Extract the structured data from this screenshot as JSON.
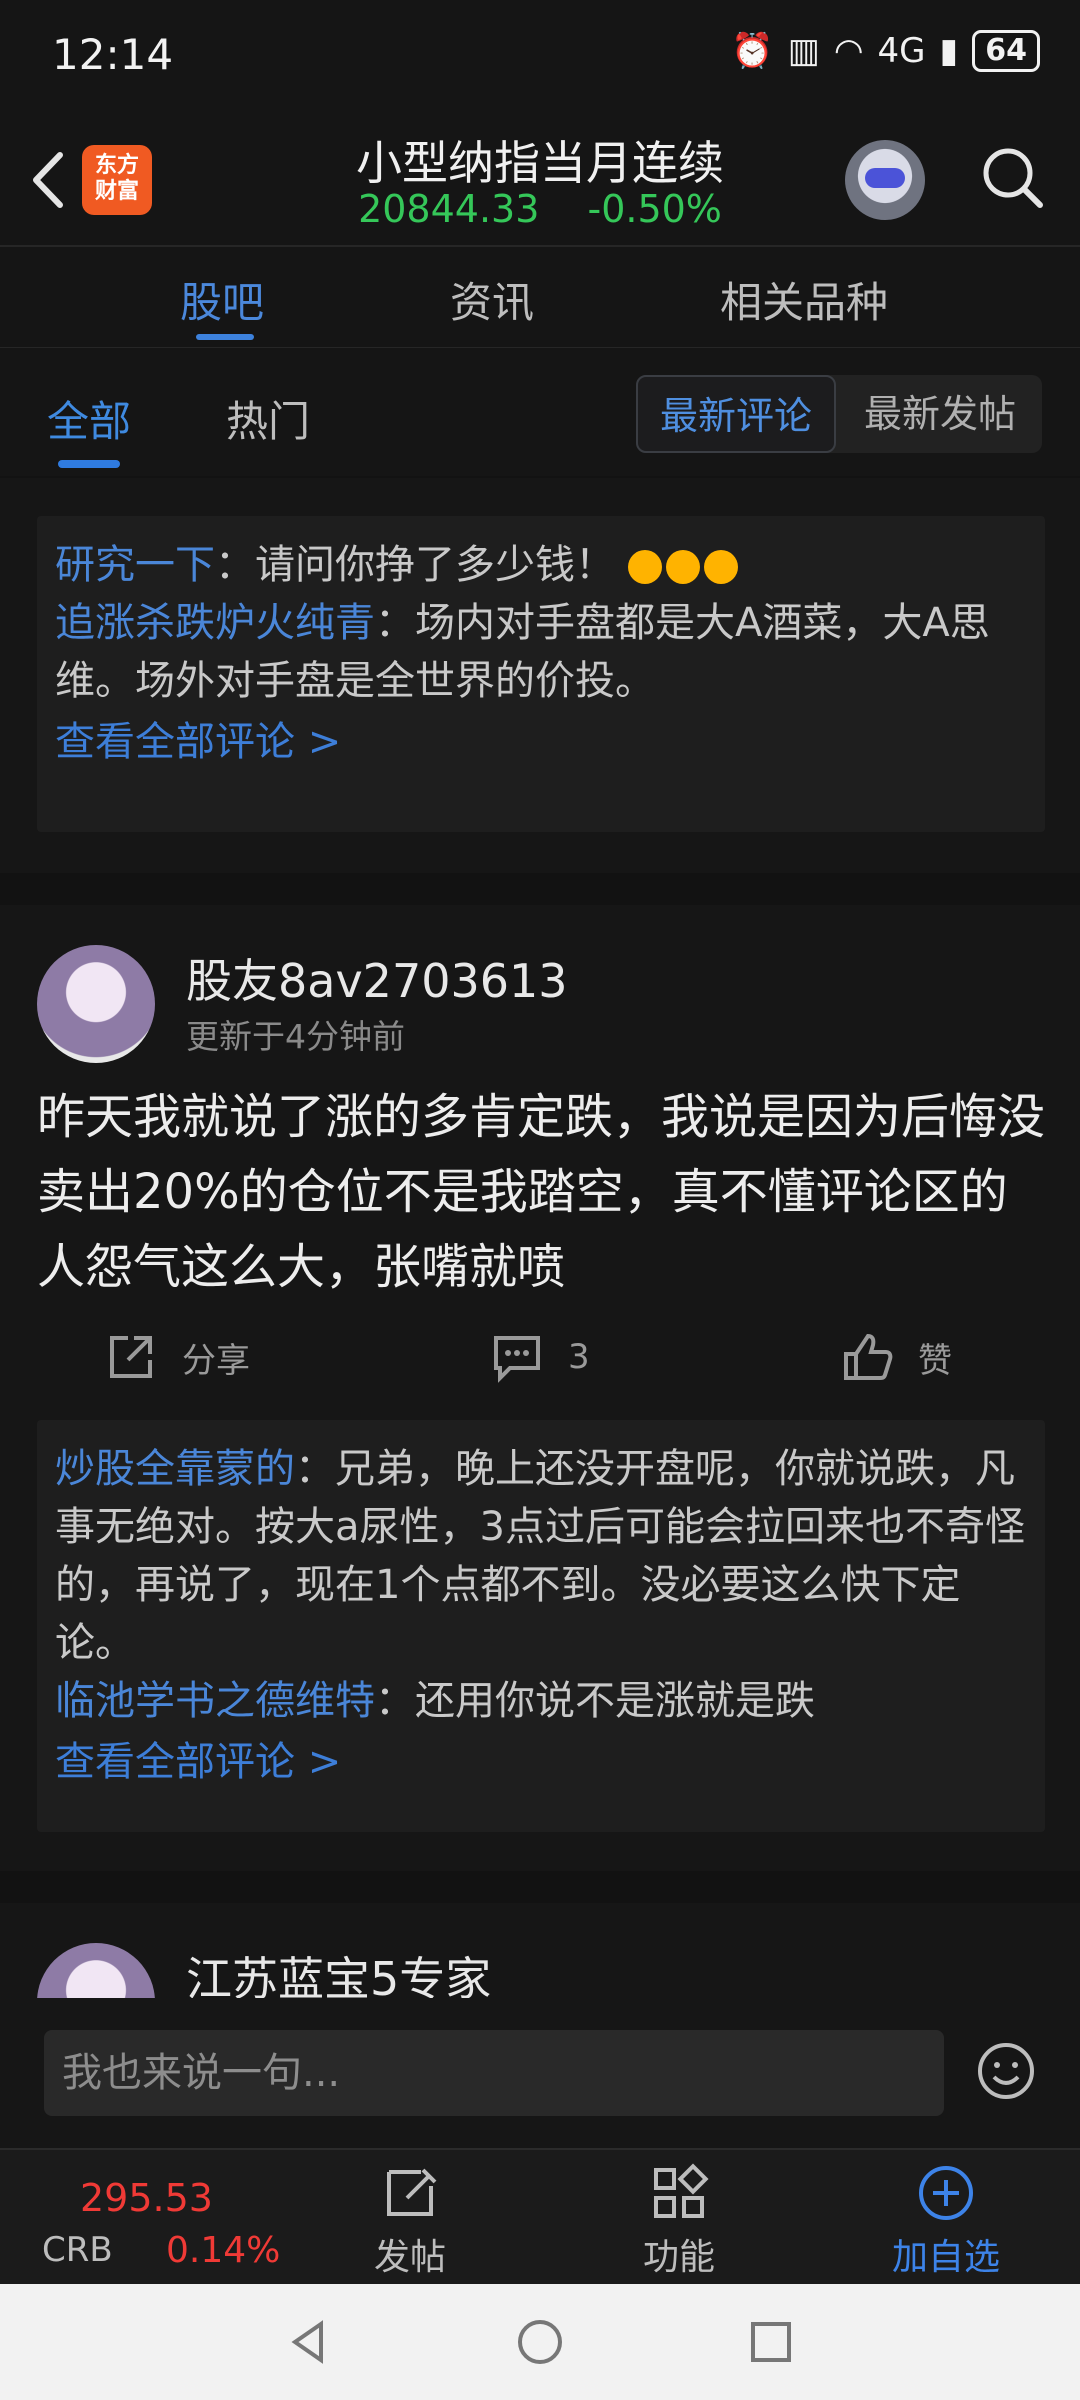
{
  "status_bar": {
    "time": "12:14",
    "network": "4G",
    "battery": "64"
  },
  "header": {
    "logo_text": "东方\n财富",
    "title": "小型纳指当月连续",
    "price": "20844.33",
    "change": "-0.50%",
    "change_color": "#35c759"
  },
  "tabs": {
    "primary": [
      "股吧",
      "资讯",
      "相关品种"
    ],
    "secondary": [
      "全部",
      "热门"
    ],
    "sort": [
      "最新评论",
      "最新发帖"
    ]
  },
  "posts": [
    {
      "comments": [
        {
          "author": "研究一下",
          "text": "：请问你挣了多少钱！"
        },
        {
          "author": "追涨杀跌炉火纯青",
          "text": "：场内对手盘都是大A酒菜，大A思维。场外对手盘是全世界的价投。"
        }
      ],
      "view_all": "查看全部评论 >"
    },
    {
      "username": "股友8av2703613",
      "time": "更新于4分钟前",
      "text": "昨天我就说了涨的多肯定跌，我说是因为后悔没卖出20%的仓位不是我踏空，真不懂评论区的人怨气这么大，张嘴就喷",
      "actions": {
        "share": "分享",
        "comment_count": "3",
        "like": "赞"
      },
      "comments": [
        {
          "author": "炒股全靠蒙的",
          "text": "：兄弟，晚上还没开盘呢，你就说跌，凡事无绝对。按大a尿性，3点过后可能会拉回来也不奇怪的，再说了，现在1个点都不到。没必要这么快下定论。"
        },
        {
          "author": "临池学书之德维特",
          "text": "：还用你说不是涨就是跌"
        }
      ],
      "view_all": "查看全部评论 >"
    },
    {
      "username": "江苏蓝宝5专家"
    }
  ],
  "input": {
    "placeholder": "我也来说一句..."
  },
  "bottom_nav": {
    "ticker_value": "295.53",
    "ticker_code": "CRB",
    "ticker_change": "0.14%",
    "items": [
      "发帖",
      "功能",
      "加自选"
    ]
  }
}
